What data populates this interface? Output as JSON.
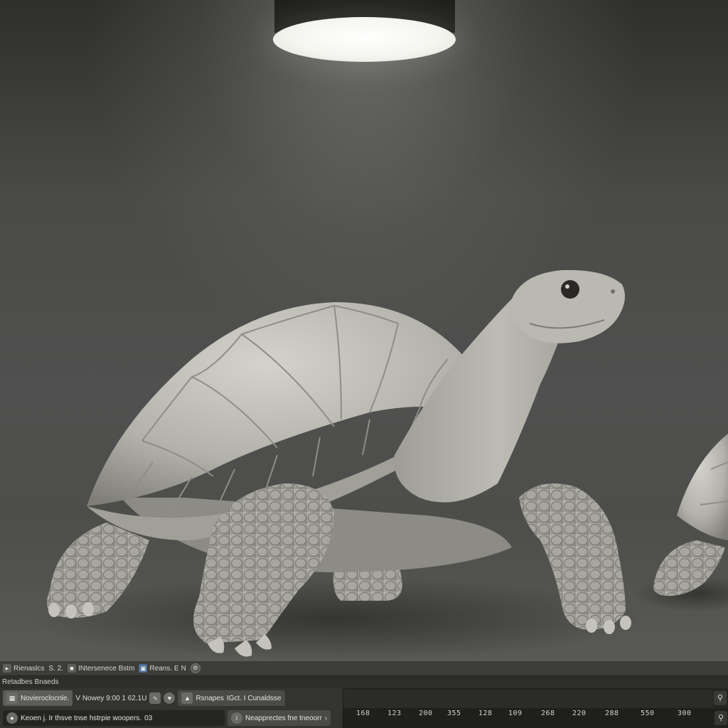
{
  "status_bar": {
    "items": [
      {
        "icon": "arrow-icon",
        "label": "Rienaslcs"
      },
      {
        "icon": "",
        "label": "S. 2."
      },
      {
        "icon": "",
        "label": "INtersenece Bstm"
      },
      {
        "icon": "image-icon",
        "label": "Reans. E"
      },
      {
        "icon": "",
        "label": "N"
      }
    ]
  },
  "panel_header": {
    "title": "Retadbes Bnaeds"
  },
  "toolbar_row1": {
    "mode_button": "Novieroclocnle.",
    "info_text": "V Nowey 9:00 1 62.1U",
    "props_button": "Rsnapes",
    "props_info": "IGct. I Cunaldsse"
  },
  "toolbar_row2": {
    "status_text": "Keoen j. Ir thsve tnse hstrpie woopers.",
    "status_num": "03",
    "hint_button": "Neapprectes fne tneoorr"
  },
  "timeline": {
    "ticks": [
      "168",
      "123",
      "200",
      "355",
      "128",
      "109",
      "268",
      "220",
      "288",
      "550",
      "300"
    ]
  },
  "colors": {
    "viewport_bg": "#4f4f4c",
    "panel_bg": "#2a2a29",
    "lamp": "#f4f4ef"
  }
}
